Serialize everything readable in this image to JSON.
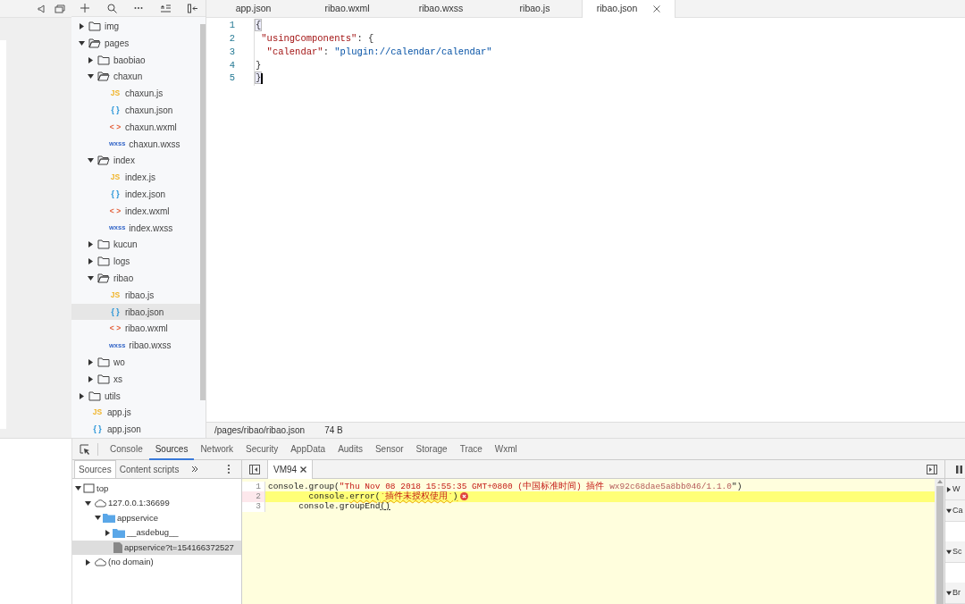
{
  "file_tree": {
    "items": [
      {
        "name": "img",
        "kind": "folder",
        "expanded": false,
        "selected": false
      },
      {
        "name": "pages",
        "kind": "folder",
        "expanded": true,
        "selected": false,
        "children": [
          {
            "name": "baobiao",
            "kind": "folder",
            "expanded": false,
            "selected": false
          },
          {
            "name": "chaxun",
            "kind": "folder",
            "expanded": true,
            "selected": false,
            "children": [
              {
                "name": "chaxun.js",
                "kind": "js",
                "icon": "JS",
                "selected": false
              },
              {
                "name": "chaxun.json",
                "kind": "json",
                "icon": "{ }",
                "selected": false
              },
              {
                "name": "chaxun.wxml",
                "kind": "wxml",
                "icon": "< >",
                "selected": false
              },
              {
                "name": "chaxun.wxss",
                "kind": "wxss",
                "icon": "wxss",
                "selected": false
              }
            ]
          },
          {
            "name": "index",
            "kind": "folder",
            "expanded": true,
            "selected": false,
            "children": [
              {
                "name": "index.js",
                "kind": "js",
                "icon": "JS",
                "selected": false
              },
              {
                "name": "index.json",
                "kind": "json",
                "icon": "{ }",
                "selected": false
              },
              {
                "name": "index.wxml",
                "kind": "wxml",
                "icon": "< >",
                "selected": false
              },
              {
                "name": "index.wxss",
                "kind": "wxss",
                "icon": "wxss",
                "selected": false
              }
            ]
          },
          {
            "name": "kucun",
            "kind": "folder",
            "expanded": false,
            "selected": false
          },
          {
            "name": "logs",
            "kind": "folder",
            "expanded": false,
            "selected": false
          },
          {
            "name": "ribao",
            "kind": "folder",
            "expanded": true,
            "selected": false,
            "children": [
              {
                "name": "ribao.js",
                "kind": "js",
                "icon": "JS",
                "selected": false
              },
              {
                "name": "ribao.json",
                "kind": "json",
                "icon": "{ }",
                "selected": true
              },
              {
                "name": "ribao.wxml",
                "kind": "wxml",
                "icon": "< >",
                "selected": false
              },
              {
                "name": "ribao.wxss",
                "kind": "wxss",
                "icon": "wxss",
                "selected": false
              }
            ]
          },
          {
            "name": "wo",
            "kind": "folder",
            "expanded": false,
            "selected": false
          },
          {
            "name": "xs",
            "kind": "folder",
            "expanded": false,
            "selected": false
          }
        ]
      },
      {
        "name": "utils",
        "kind": "folder",
        "expanded": false,
        "selected": false
      },
      {
        "name": "app.js",
        "kind": "js",
        "icon": "JS",
        "selected": false
      },
      {
        "name": "app.json",
        "kind": "json",
        "icon": "{ }",
        "selected": false
      }
    ]
  },
  "editor": {
    "tabs": [
      {
        "label": "app.json",
        "selected": false
      },
      {
        "label": "ribao.wxml",
        "selected": false
      },
      {
        "label": "ribao.wxss",
        "selected": false
      },
      {
        "label": "ribao.js",
        "selected": false
      },
      {
        "label": "ribao.json",
        "selected": true
      }
    ],
    "lines": [
      {
        "number": "1",
        "cursor": false,
        "tokens": [
          {
            "text": "{",
            "kind": "bracket"
          }
        ]
      },
      {
        "number": "2",
        "cursor": false,
        "tokens": [
          {
            "text": " \"usingComponents\"",
            "kind": "key"
          },
          {
            "text": ": {",
            "kind": "plain"
          }
        ]
      },
      {
        "number": "3",
        "cursor": false,
        "tokens": [
          {
            "text": "  \"calendar\"",
            "kind": "key"
          },
          {
            "text": ": ",
            "kind": "plain"
          },
          {
            "text": "\"plugin://calendar/calendar\"",
            "kind": "string"
          }
        ]
      },
      {
        "number": "4",
        "cursor": false,
        "tokens": [
          {
            "text": "}",
            "kind": "plain"
          }
        ]
      },
      {
        "number": "5",
        "cursor": true,
        "tokens": [
          {
            "text": "}",
            "kind": "bracket"
          }
        ]
      }
    ]
  },
  "status_bar": {
    "path": "/pages/ribao/ribao.json",
    "size": "74 B"
  },
  "devtools": {
    "tabs": [
      {
        "label": "Console",
        "selected": false
      },
      {
        "label": "Sources",
        "selected": true
      },
      {
        "label": "Network",
        "selected": false
      },
      {
        "label": "Security",
        "selected": false
      },
      {
        "label": "AppData",
        "selected": false
      },
      {
        "label": "Audits",
        "selected": false
      },
      {
        "label": "Sensor",
        "selected": false
      },
      {
        "label": "Storage",
        "selected": false
      },
      {
        "label": "Trace",
        "selected": false
      },
      {
        "label": "Wxml",
        "selected": false
      }
    ],
    "navigator_tabs": [
      {
        "label": "Sources",
        "selected": true
      },
      {
        "label": "Content scripts",
        "selected": false
      }
    ],
    "navigator_tree": [
      {
        "name": "top",
        "kind": "frame",
        "expanded": true,
        "selected": false,
        "children": [
          {
            "name": "127.0.0.1:36699",
            "kind": "origin",
            "expanded": true,
            "selected": false,
            "children": [
              {
                "name": "appservice",
                "kind": "folder",
                "expanded": true,
                "selected": false,
                "children": [
                  {
                    "name": "__asdebug__",
                    "kind": "folder",
                    "expanded": false,
                    "selected": false
                  },
                  {
                    "name": "appservice?t=154166372527",
                    "kind": "file",
                    "selected": true
                  }
                ]
              }
            ]
          },
          {
            "name": "(no domain)",
            "kind": "origin",
            "expanded": false,
            "selected": false
          }
        ]
      }
    ],
    "source_tabs": [
      {
        "label": "VM94",
        "selected": true
      }
    ],
    "source_lines": [
      {
        "number": "1",
        "highlighted": false,
        "error": false,
        "tokens": [
          {
            "text": "console.group(",
            "kind": "plain"
          },
          {
            "text": "\"Thu Nov 08 2018 15:55:35 GMT+0800 (中国标准时间) 插件 ",
            "kind": "string"
          },
          {
            "text": "wx92c68dae5a8bb046/1.1.0",
            "kind": "dim"
          },
          {
            "text": "\")",
            "kind": "plain"
          }
        ]
      },
      {
        "number": "2",
        "highlighted": true,
        "error": true,
        "tokens": [
          {
            "text": "        console.",
            "kind": "plain"
          },
          {
            "text": "error",
            "kind": "plain",
            "squiggle": true
          },
          {
            "text": "(",
            "kind": "plain",
            "squiggle": true
          },
          {
            "text": "`插件未授权使用`",
            "kind": "string",
            "squiggle": true
          },
          {
            "text": ")",
            "kind": "plain",
            "squiggle": true
          }
        ]
      },
      {
        "number": "3",
        "highlighted": false,
        "error": false,
        "tokens": [
          {
            "text": "      console.groupEnd",
            "kind": "plain"
          },
          {
            "text": "()",
            "kind": "match"
          }
        ]
      }
    ],
    "sidebar_sections": [
      {
        "label": "W",
        "expanded": false
      },
      {
        "label": "Ca",
        "expanded": true
      },
      {
        "label": "Sc",
        "expanded": true
      },
      {
        "label": "Br",
        "expanded": true
      }
    ]
  }
}
